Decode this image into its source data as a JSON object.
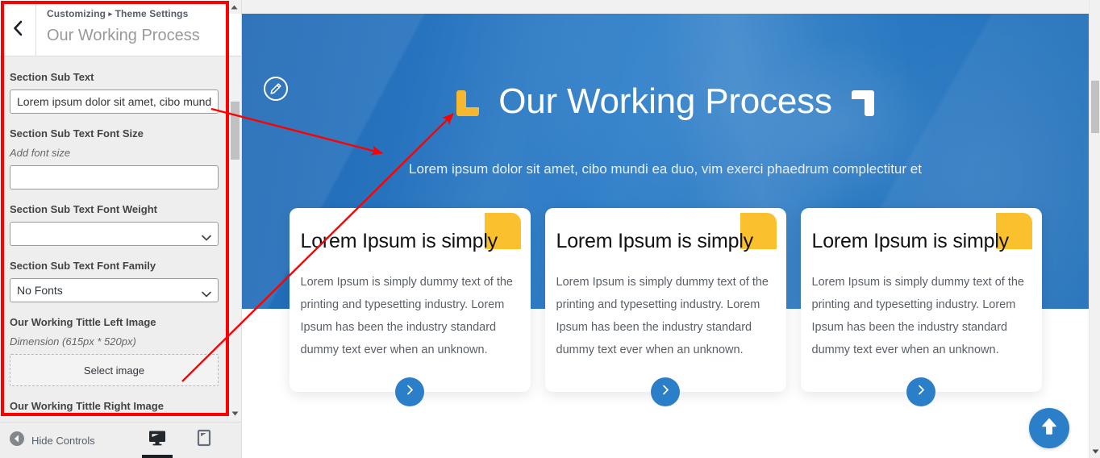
{
  "customizer": {
    "breadcrumb_prefix": "Customizing",
    "breadcrumb_separator": "▸",
    "breadcrumb_section": "Theme Settings",
    "panel_title": "Our Working Process",
    "back_icon": "chevron-left-icon",
    "controls": [
      {
        "label": "Section Sub Text",
        "type": "text",
        "value": "Lorem ipsum dolor sit amet, cibo mund",
        "placeholder": ""
      },
      {
        "label": "Section Sub Text Font Size",
        "description": "Add font size",
        "type": "text",
        "value": "",
        "placeholder": ""
      },
      {
        "label": "Section Sub Text Font Weight",
        "type": "select",
        "value": ""
      },
      {
        "label": "Section Sub Text Font Family",
        "type": "select",
        "value": "No Fonts"
      },
      {
        "label": "Our Working Tittle Left Image",
        "description": "Dimension (615px * 520px)",
        "type": "upload",
        "button_label": "Select image"
      },
      {
        "label": "Our Working Tittle Right Image",
        "type": "label-only"
      }
    ],
    "footer": {
      "hide_controls_label": "Hide Controls",
      "hide_controls_icon": "collapse-left-icon",
      "devices": [
        {
          "name": "desktop",
          "icon": "desktop-icon",
          "active": true
        },
        {
          "name": "tablet",
          "icon": "tablet-icon",
          "active": false
        },
        {
          "name": "mobile",
          "icon": "mobile-icon",
          "active": false
        }
      ]
    }
  },
  "preview": {
    "edit_icon": "pencil-edit-icon",
    "hero": {
      "title": "Our Working Process",
      "left_decoration_icon": "corner-bracket-left-icon",
      "right_decoration_icon": "corner-bracket-right-icon",
      "subtitle": "Lorem ipsum dolor sit amet, cibo mundi ea duo, vim exerci phaedrum complectitur et"
    },
    "cards": [
      {
        "title": "Lorem Ipsum is simply",
        "body": "Lorem Ipsum is simply dummy text of the printing and typesetting industry. Lorem Ipsum has been the industry standard dummy text ever when an unknown.",
        "arrow_icon": "chevron-right-icon"
      },
      {
        "title": "Lorem Ipsum is simply",
        "body": "Lorem Ipsum is simply dummy text of the printing and typesetting industry. Lorem Ipsum has been the industry standard dummy text ever when an unknown.",
        "arrow_icon": "chevron-right-icon"
      },
      {
        "title": "Lorem Ipsum is simply",
        "body": "Lorem Ipsum is simply dummy text of the printing and typesetting industry. Lorem Ipsum has been the industry standard dummy text ever when an unknown.",
        "arrow_icon": "chevron-right-icon"
      }
    ],
    "scroll_top_icon": "arrow-up-icon"
  },
  "colors": {
    "hero_blue": "#2b7fc9",
    "accent_yellow": "#fbc02d",
    "annotation_red": "#ff0000",
    "sidebar_bg": "#eeeeee"
  }
}
